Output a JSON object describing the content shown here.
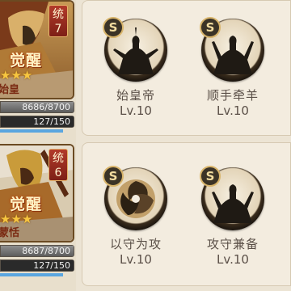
{
  "generals": [
    {
      "tong_char": "统",
      "tong_value": "7",
      "awaken": "觉醒",
      "name": "始皇",
      "stars": "★★★",
      "hp_text": "8686/8700",
      "hp_ratio": 0.998,
      "sp_text": "127/150",
      "sp_ratio": 0.847
    },
    {
      "tong_char": "统",
      "tong_value": "6",
      "awaken": "觉醒",
      "name": "蒙恬",
      "stars": "★★★",
      "hp_text": "8687/8700",
      "hp_ratio": 0.998,
      "sp_text": "127/150",
      "sp_ratio": 0.847
    }
  ],
  "skills": [
    {
      "grade": "S",
      "name": "始皇帝",
      "level": "Lv.10",
      "icon": "warrior-silhouette-icon"
    },
    {
      "grade": "S",
      "name": "顺手牵羊",
      "level": "Lv.10",
      "icon": "warrior-silhouette-icon"
    },
    {
      "grade": "S",
      "name": "以守为攻",
      "level": "Lv.10",
      "icon": "swirl-shield-icon"
    },
    {
      "grade": "S",
      "name": "攻守兼备",
      "level": "Lv.10",
      "icon": "warrior-silhouette-icon"
    }
  ]
}
